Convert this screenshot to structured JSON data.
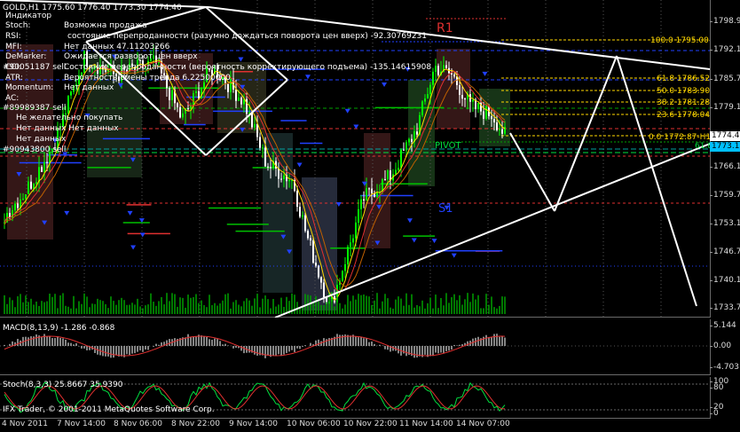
{
  "symbol_header": "GOLD,H1  1775.60 1776.40 1773.30 1774.40",
  "info_panel": [
    {
      "key": "Индикатор",
      "value": ""
    },
    {
      "key": "Stoch:",
      "value": "Возможна продажа"
    },
    {
      "key": "RSI:",
      "value": "состояние перепроданности (разумно дождаться поворота цен вверх) -92.30769231"
    },
    {
      "key": "MFI:",
      "value": "Нет данных 47.11203266"
    },
    {
      "key": "DeMarker:",
      "value": "Ожидается разворот цен вверх"
    },
    {
      "key": "CCI:",
      "value": "Состояние перепроданности (вероятность корректирующего подъема) -135.14615908"
    },
    {
      "key": "ATR:",
      "value": "Вероятность смены тренда 6.22500000"
    },
    {
      "key": "Momentum:",
      "value": "Нет данных"
    },
    {
      "key": "AC:",
      "value": ""
    }
  ],
  "advice_lines": [
    "Не желательно покупать",
    "Нет данных Нет данных",
    "Нет данных"
  ],
  "sell_labels": [
    "#90051187 sell",
    "#89989387 sell",
    "#90943800 sell"
  ],
  "levels": {
    "r1": "R1",
    "pivot": "PIVOT",
    "s1": "S1",
    "fib": [
      {
        "label": "100.0 1795.00-H1"
      },
      {
        "label": "61.8 1786.52-H1"
      },
      {
        "label": "50.0 1783.90-H1"
      },
      {
        "label": "38.2 1781.28-H1"
      },
      {
        "label": "23.6 1778.04-H1"
      },
      {
        "label": "0.0 1772.87-H1"
      },
      {
        "label": "61.8"
      }
    ]
  },
  "price_axis": [
    "1798.90",
    "1792.10",
    "1785.70",
    "1779.10",
    "1772.70",
    "1766.10",
    "1759.70",
    "1753.10",
    "1746.70",
    "1740.10",
    "1733.70"
  ],
  "current_price": "1774.40",
  "current_price_2": "1773.10",
  "macd": {
    "label": "MACD(8,13,9) -1.286 -0.868",
    "axis": [
      "5.144",
      "0.00",
      "-4.703"
    ]
  },
  "stoch": {
    "label": "Stoch(8,3,3) 25.8667 35.9390",
    "axis": [
      "100",
      "80",
      "20",
      "0"
    ]
  },
  "copyright": "IFX Trader, © 2001-2011 MetaQuotes Software Corp.",
  "time_axis": [
    "4 Nov 2011",
    "7 Nov 14:00",
    "8 Nov 06:00",
    "8 Nov 22:00",
    "9 Nov 14:00",
    "10 Nov 06:00",
    "10 Nov 22:00",
    "11 Nov 14:00",
    "14 Nov 07:00"
  ],
  "colors": {
    "bull": "#00ff00",
    "bear": "#ffffff",
    "up_arrow": "#2040ff",
    "resistance": "#e03030",
    "support": "#2040ff",
    "fib": "#ffd800",
    "macd_signal": "#e03030",
    "stoch_signal": "#e03030"
  }
}
